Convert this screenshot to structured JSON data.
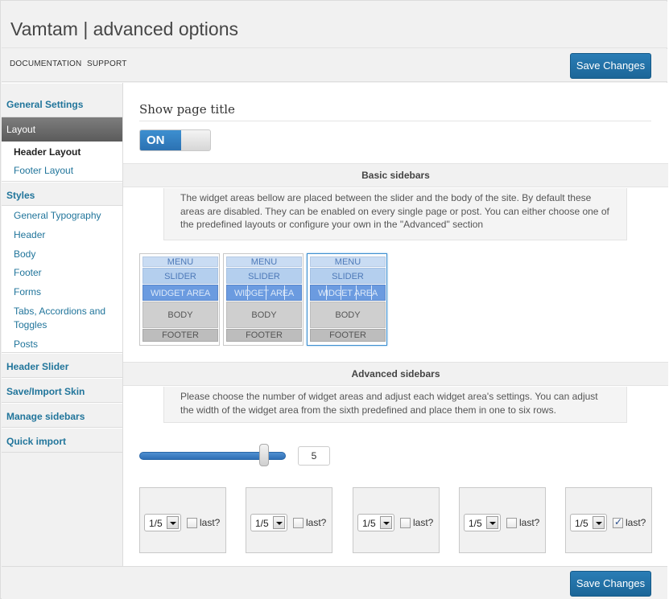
{
  "window": {
    "title": "Vamtam | advanced options"
  },
  "topbar": {
    "links": [
      "DOCUMENTATION",
      "SUPPORT"
    ],
    "save_label": "Save Changes"
  },
  "sidebar": {
    "general": "General Settings",
    "layout": "Layout",
    "layout_items": [
      "Header Layout",
      "Footer Layout"
    ],
    "styles": "Styles",
    "style_items": [
      "General Typography",
      "Header",
      "Body",
      "Footer",
      "Forms",
      "Tabs, Accordions and Toggles",
      "Posts"
    ],
    "header_slider": "Header Slider",
    "save_import": "Save/Import Skin",
    "manage_sidebars": "Manage sidebars",
    "quick_import": "Quick import"
  },
  "main": {
    "show_page_title": {
      "label": "Show page title",
      "state": "ON"
    },
    "basic_sidebars": {
      "title": "Basic sidebars",
      "description": "The widget areas bellow are placed between the slider and the body of the site. By default these areas are disabled. They can be enabled on every single page or post. You can either choose one of the predefined layouts or configure your own in the \"Advanced\" section",
      "layout_labels": {
        "menu": "MENU",
        "slider": "SLIDER",
        "widget": "WIDGET AREA",
        "body": "BODY",
        "footer": "FOOTER"
      },
      "selected_layout": 3
    },
    "advanced_sidebars": {
      "title": "Advanced sidebars",
      "description": "Please choose the number of widget areas and adjust each widget area's settings. You can adjust the width of the widget area from the sixth predefined and place them in one to six rows.",
      "count": "5",
      "count_fraction": 0.8,
      "widgets": [
        {
          "width": "1/5",
          "last_label": "last?",
          "last": false
        },
        {
          "width": "1/5",
          "last_label": "last?",
          "last": false
        },
        {
          "width": "1/5",
          "last_label": "last?",
          "last": false
        },
        {
          "width": "1/5",
          "last_label": "last?",
          "last": false
        },
        {
          "width": "1/5",
          "last_label": "last?",
          "last": true
        }
      ]
    }
  },
  "footer": {
    "save_label": "Save Changes"
  },
  "colors": {
    "accent": "#21759b",
    "button": "#2a7db6",
    "toggle_on": "#3d8fd0"
  }
}
